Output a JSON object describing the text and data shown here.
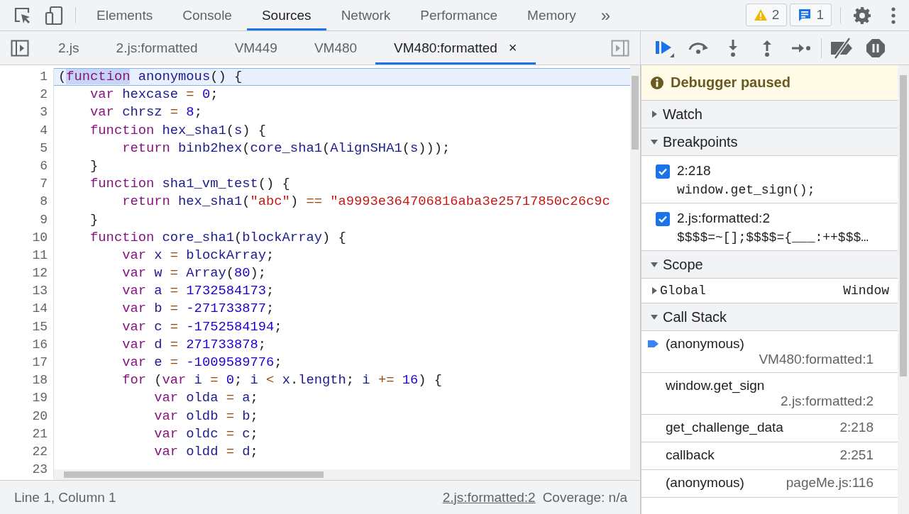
{
  "toolbar": {
    "tabs": [
      {
        "label": "Elements",
        "selected": false
      },
      {
        "label": "Console",
        "selected": false
      },
      {
        "label": "Sources",
        "selected": true
      },
      {
        "label": "Network",
        "selected": false
      },
      {
        "label": "Performance",
        "selected": false
      },
      {
        "label": "Memory",
        "selected": false
      }
    ],
    "more": "»",
    "warnings": "2",
    "messages": "1"
  },
  "file_tabs": [
    {
      "label": "2.js",
      "selected": false
    },
    {
      "label": "2.js:formatted",
      "selected": false
    },
    {
      "label": "VM449",
      "selected": false
    },
    {
      "label": "VM480",
      "selected": false
    },
    {
      "label": "VM480:formatted",
      "selected": true,
      "close": "×"
    }
  ],
  "editor": {
    "lines": [
      {
        "number": "1",
        "current": true,
        "tokens": [
          {
            "text": "(",
            "kind": "p"
          },
          {
            "text": "function",
            "kind": "kw",
            "highlighted": true
          },
          {
            "text": " anonymous",
            "kind": "id"
          },
          {
            "text": "() {",
            "kind": "p"
          }
        ]
      },
      {
        "number": "2",
        "current": false,
        "tokens": [
          {
            "text": "    var",
            "kind": "kw"
          },
          {
            "text": " hexcase",
            "kind": "id"
          },
          {
            "text": " =",
            "kind": "op"
          },
          {
            "text": " 0",
            "kind": "num"
          },
          {
            "text": ";",
            "kind": "p"
          }
        ]
      },
      {
        "number": "3",
        "current": false,
        "tokens": [
          {
            "text": "    var",
            "kind": "kw"
          },
          {
            "text": " chrsz",
            "kind": "id"
          },
          {
            "text": " =",
            "kind": "op"
          },
          {
            "text": " 8",
            "kind": "num"
          },
          {
            "text": ";",
            "kind": "p"
          }
        ]
      },
      {
        "number": "4",
        "current": false,
        "tokens": [
          {
            "text": "    function",
            "kind": "kw"
          },
          {
            "text": " hex_sha1",
            "kind": "id"
          },
          {
            "text": "(",
            "kind": "p"
          },
          {
            "text": "s",
            "kind": "id"
          },
          {
            "text": ") {",
            "kind": "p"
          }
        ]
      },
      {
        "number": "5",
        "current": false,
        "tokens": [
          {
            "text": "        return",
            "kind": "kw"
          },
          {
            "text": " binb2hex",
            "kind": "id"
          },
          {
            "text": "(",
            "kind": "p"
          },
          {
            "text": "core_sha1",
            "kind": "id"
          },
          {
            "text": "(",
            "kind": "p"
          },
          {
            "text": "AlignSHA1",
            "kind": "id"
          },
          {
            "text": "(",
            "kind": "p"
          },
          {
            "text": "s",
            "kind": "id"
          },
          {
            "text": ")));",
            "kind": "p"
          }
        ]
      },
      {
        "number": "6",
        "current": false,
        "tokens": [
          {
            "text": "    }",
            "kind": "p"
          }
        ]
      },
      {
        "number": "7",
        "current": false,
        "tokens": [
          {
            "text": "    function",
            "kind": "kw"
          },
          {
            "text": " sha1_vm_test",
            "kind": "id"
          },
          {
            "text": "() {",
            "kind": "p"
          }
        ]
      },
      {
        "number": "8",
        "current": false,
        "tokens": [
          {
            "text": "        return",
            "kind": "kw"
          },
          {
            "text": " hex_sha1",
            "kind": "id"
          },
          {
            "text": "(",
            "kind": "p"
          },
          {
            "text": "\"abc\"",
            "kind": "str"
          },
          {
            "text": ")",
            "kind": "p"
          },
          {
            "text": " ==",
            "kind": "op"
          },
          {
            "text": " \"a9993e364706816aba3e25717850c26c9c",
            "kind": "str"
          }
        ]
      },
      {
        "number": "9",
        "current": false,
        "tokens": [
          {
            "text": "    }",
            "kind": "p"
          }
        ]
      },
      {
        "number": "10",
        "current": false,
        "tokens": [
          {
            "text": "    function",
            "kind": "kw"
          },
          {
            "text": " core_sha1",
            "kind": "id"
          },
          {
            "text": "(",
            "kind": "p"
          },
          {
            "text": "blockArray",
            "kind": "id"
          },
          {
            "text": ") {",
            "kind": "p"
          }
        ]
      },
      {
        "number": "11",
        "current": false,
        "tokens": [
          {
            "text": "        var",
            "kind": "kw"
          },
          {
            "text": " x",
            "kind": "id"
          },
          {
            "text": " =",
            "kind": "op"
          },
          {
            "text": " blockArray",
            "kind": "id"
          },
          {
            "text": ";",
            "kind": "p"
          }
        ]
      },
      {
        "number": "12",
        "current": false,
        "tokens": [
          {
            "text": "        var",
            "kind": "kw"
          },
          {
            "text": " w",
            "kind": "id"
          },
          {
            "text": " =",
            "kind": "op"
          },
          {
            "text": " Array",
            "kind": "id"
          },
          {
            "text": "(",
            "kind": "p"
          },
          {
            "text": "80",
            "kind": "num"
          },
          {
            "text": ");",
            "kind": "p"
          }
        ]
      },
      {
        "number": "13",
        "current": false,
        "tokens": [
          {
            "text": "        var",
            "kind": "kw"
          },
          {
            "text": " a",
            "kind": "id"
          },
          {
            "text": " =",
            "kind": "op"
          },
          {
            "text": " 1732584173",
            "kind": "num"
          },
          {
            "text": ";",
            "kind": "p"
          }
        ]
      },
      {
        "number": "14",
        "current": false,
        "tokens": [
          {
            "text": "        var",
            "kind": "kw"
          },
          {
            "text": " b",
            "kind": "id"
          },
          {
            "text": " =",
            "kind": "op"
          },
          {
            "text": " -271733877",
            "kind": "num"
          },
          {
            "text": ";",
            "kind": "p"
          }
        ]
      },
      {
        "number": "15",
        "current": false,
        "tokens": [
          {
            "text": "        var",
            "kind": "kw"
          },
          {
            "text": " c",
            "kind": "id"
          },
          {
            "text": " =",
            "kind": "op"
          },
          {
            "text": " -1752584194",
            "kind": "num"
          },
          {
            "text": ";",
            "kind": "p"
          }
        ]
      },
      {
        "number": "16",
        "current": false,
        "tokens": [
          {
            "text": "        var",
            "kind": "kw"
          },
          {
            "text": " d",
            "kind": "id"
          },
          {
            "text": " =",
            "kind": "op"
          },
          {
            "text": " 271733878",
            "kind": "num"
          },
          {
            "text": ";",
            "kind": "p"
          }
        ]
      },
      {
        "number": "17",
        "current": false,
        "tokens": [
          {
            "text": "        var",
            "kind": "kw"
          },
          {
            "text": " e",
            "kind": "id"
          },
          {
            "text": " =",
            "kind": "op"
          },
          {
            "text": " -1009589776",
            "kind": "num"
          },
          {
            "text": ";",
            "kind": "p"
          }
        ]
      },
      {
        "number": "18",
        "current": false,
        "tokens": [
          {
            "text": "        for",
            "kind": "kw"
          },
          {
            "text": " (",
            "kind": "p"
          },
          {
            "text": "var",
            "kind": "kw"
          },
          {
            "text": " i",
            "kind": "id"
          },
          {
            "text": " =",
            "kind": "op"
          },
          {
            "text": " 0",
            "kind": "num"
          },
          {
            "text": ";",
            "kind": "p"
          },
          {
            "text": " i",
            "kind": "id"
          },
          {
            "text": " <",
            "kind": "op"
          },
          {
            "text": " x",
            "kind": "id"
          },
          {
            "text": ".",
            "kind": "p"
          },
          {
            "text": "length",
            "kind": "id"
          },
          {
            "text": ";",
            "kind": "p"
          },
          {
            "text": " i",
            "kind": "id"
          },
          {
            "text": " +=",
            "kind": "op"
          },
          {
            "text": " 16",
            "kind": "num"
          },
          {
            "text": ") {",
            "kind": "p"
          }
        ]
      },
      {
        "number": "19",
        "current": false,
        "tokens": [
          {
            "text": "            var",
            "kind": "kw"
          },
          {
            "text": " olda",
            "kind": "id"
          },
          {
            "text": " =",
            "kind": "op"
          },
          {
            "text": " a",
            "kind": "id"
          },
          {
            "text": ";",
            "kind": "p"
          }
        ]
      },
      {
        "number": "20",
        "current": false,
        "tokens": [
          {
            "text": "            var",
            "kind": "kw"
          },
          {
            "text": " oldb",
            "kind": "id"
          },
          {
            "text": " =",
            "kind": "op"
          },
          {
            "text": " b",
            "kind": "id"
          },
          {
            "text": ";",
            "kind": "p"
          }
        ]
      },
      {
        "number": "21",
        "current": false,
        "tokens": [
          {
            "text": "            var",
            "kind": "kw"
          },
          {
            "text": " oldc",
            "kind": "id"
          },
          {
            "text": " =",
            "kind": "op"
          },
          {
            "text": " c",
            "kind": "id"
          },
          {
            "text": ";",
            "kind": "p"
          }
        ]
      },
      {
        "number": "22",
        "current": false,
        "tokens": [
          {
            "text": "            var",
            "kind": "kw"
          },
          {
            "text": " oldd",
            "kind": "id"
          },
          {
            "text": " =",
            "kind": "op"
          },
          {
            "text": " d",
            "kind": "id"
          },
          {
            "text": ";",
            "kind": "p"
          }
        ]
      },
      {
        "number": "23",
        "current": false
      }
    ]
  },
  "status_bar": {
    "position": "Line 1, Column 1",
    "source_link": "2.js:formatted:2",
    "coverage": "Coverage: n/a"
  },
  "debugger": {
    "banner": "Debugger paused",
    "sections": [
      {
        "title": "Watch",
        "expanded": false
      },
      {
        "kind": "breakpoints",
        "title": "Breakpoints",
        "expanded": true,
        "breakpoints": [
          {
            "location": "2:218",
            "code": "window.get_sign();",
            "checked": true
          },
          {
            "location": "2.js:formatted:2",
            "code": "$$$$=~[];$$$$={___:++$$$…",
            "checked": true
          }
        ]
      },
      {
        "kind": "scope",
        "title": "Scope",
        "expanded": true,
        "scopes": [
          {
            "name": "Global",
            "value": "Window",
            "expanded": false
          }
        ]
      },
      {
        "kind": "callstack",
        "title": "Call Stack",
        "expanded": true,
        "frames": [
          {
            "function": "(anonymous)",
            "location": "VM480:formatted:1",
            "current": true,
            "kind": "stacked"
          },
          {
            "function": "window.get_sign",
            "location": "2.js:formatted:2",
            "current": false,
            "kind": "stacked"
          },
          {
            "function": "get_challenge_data",
            "location": "2:218",
            "current": false,
            "kind": "inline"
          },
          {
            "function": "callback",
            "location": "2:251",
            "current": false,
            "kind": "inline"
          },
          {
            "function": "(anonymous)",
            "location": "pageMe.js:116",
            "current": false,
            "kind": "inline"
          }
        ]
      }
    ]
  }
}
